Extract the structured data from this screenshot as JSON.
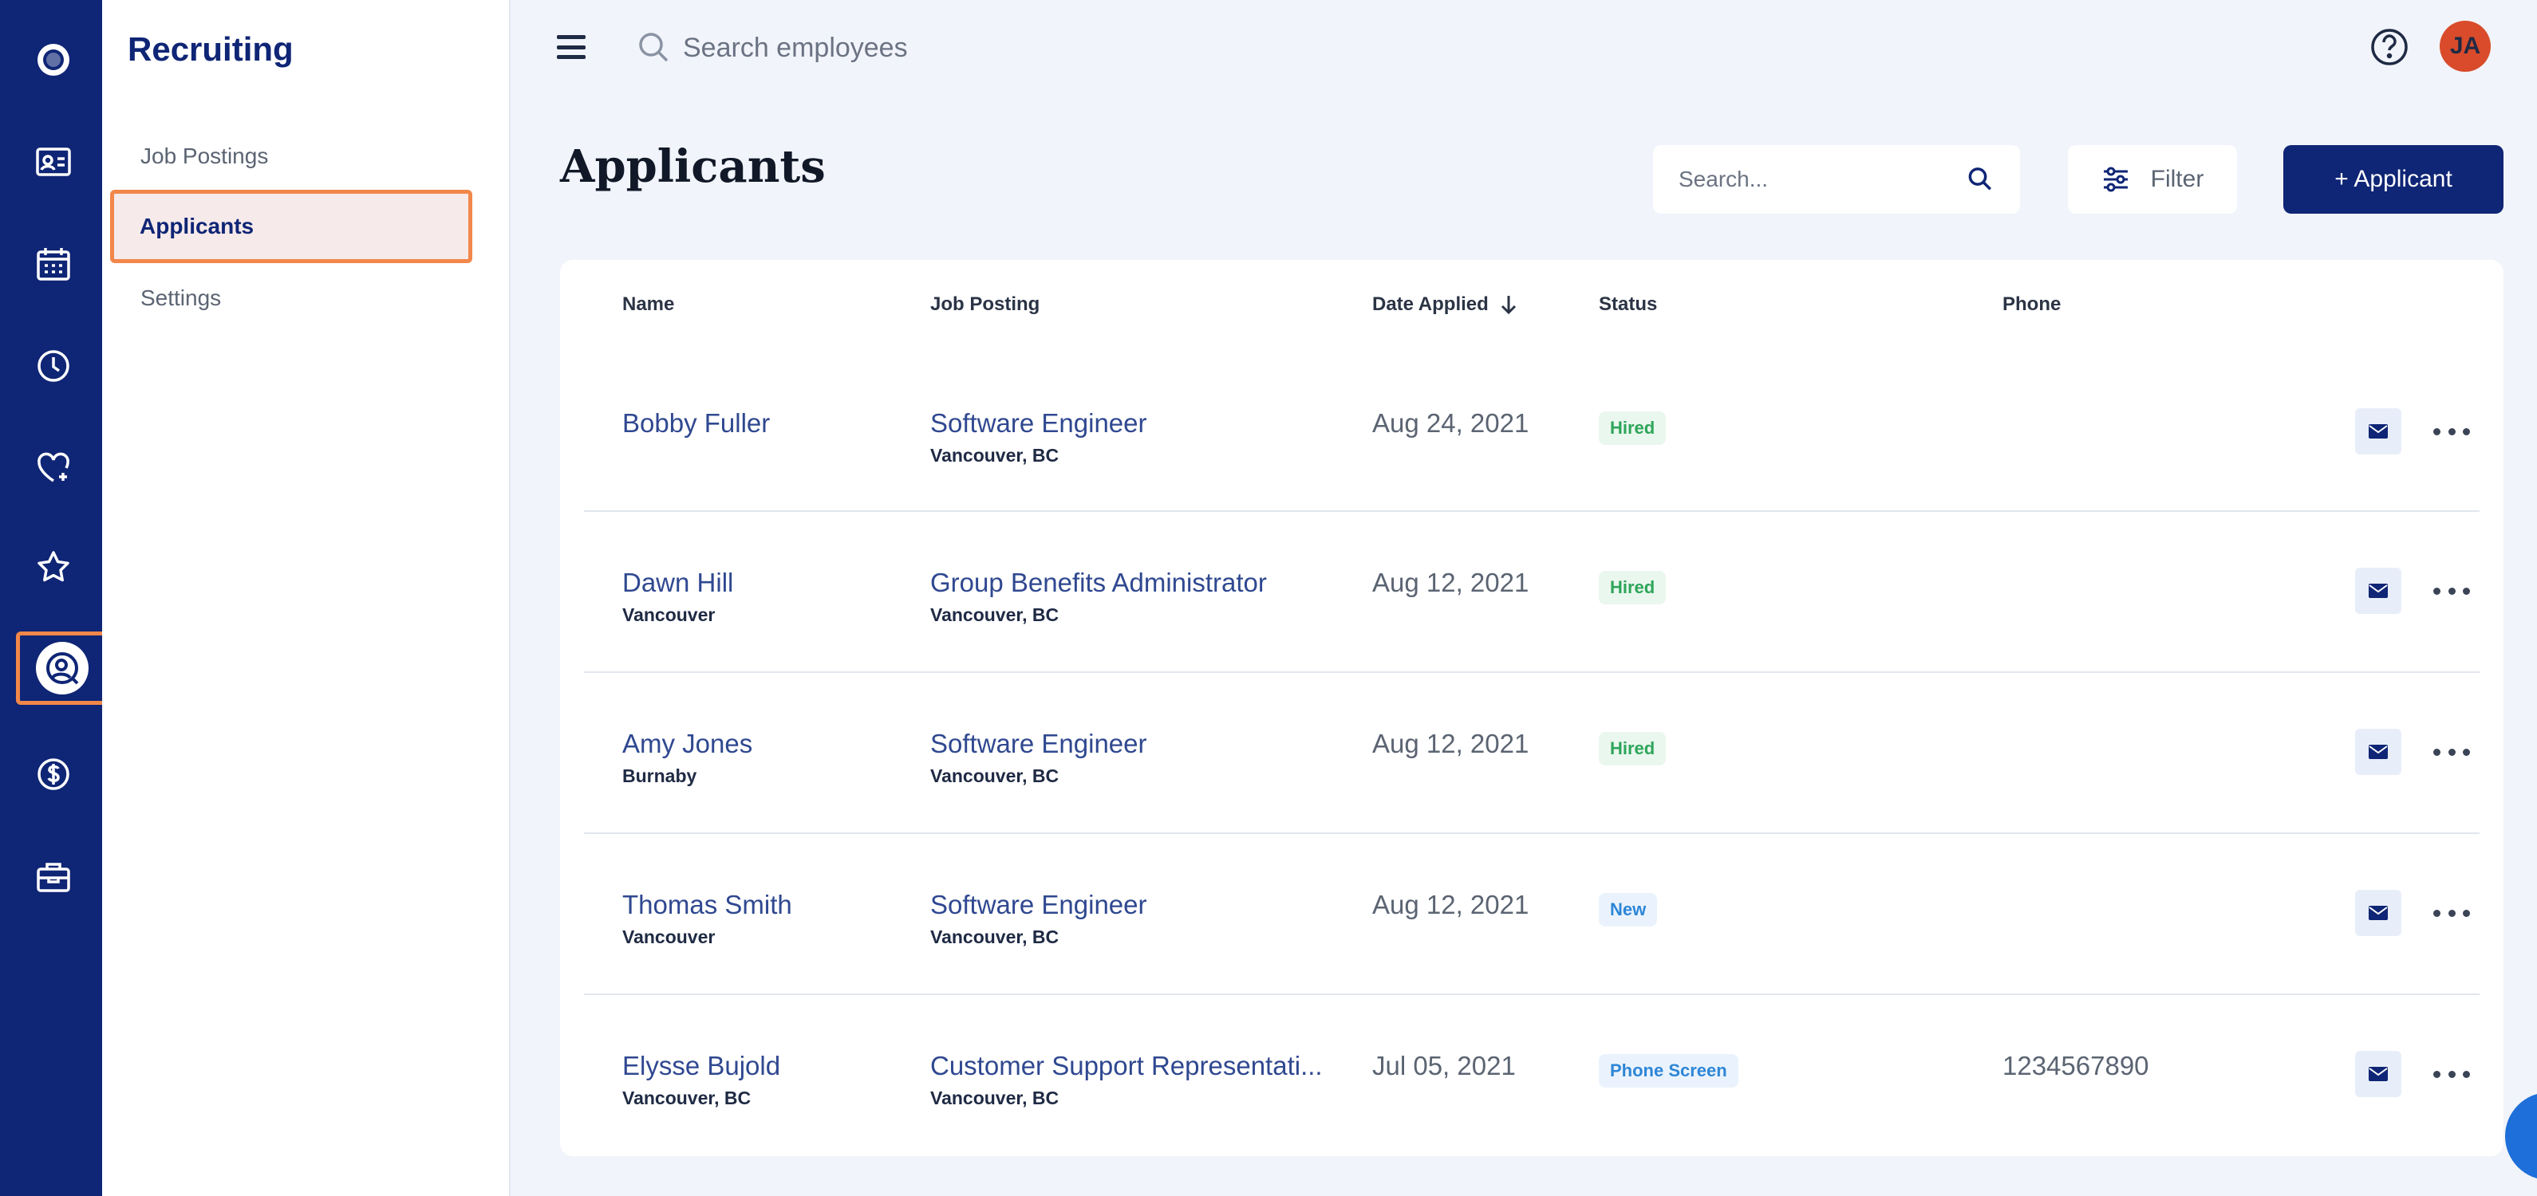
{
  "global_search": {
    "placeholder": "Search employees"
  },
  "user": {
    "initials": "JA"
  },
  "rail": {
    "items": [
      {
        "icon": "app-logo-icon"
      },
      {
        "icon": "id-card-icon"
      },
      {
        "icon": "calendar-icon"
      },
      {
        "icon": "clock-icon"
      },
      {
        "icon": "heart-plus-icon"
      },
      {
        "icon": "star-icon"
      },
      {
        "icon": "recruiting-person-search-icon",
        "active": true
      },
      {
        "icon": "dollar-icon"
      },
      {
        "icon": "toolbox-icon"
      }
    ]
  },
  "subnav": {
    "title": "Recruiting",
    "items": [
      {
        "label": "Job Postings"
      },
      {
        "label": "Applicants",
        "active": true
      },
      {
        "label": "Settings"
      }
    ]
  },
  "page": {
    "title": "Applicants",
    "search_placeholder": "Search...",
    "filter_label": "Filter",
    "add_label": "+ Applicant"
  },
  "table": {
    "columns": [
      "Name",
      "Job Posting",
      "Date Applied",
      "Status",
      "Phone"
    ],
    "rows": [
      {
        "name": "Bobby Fuller",
        "location": "",
        "job": "Software Engineer",
        "job_location": "Vancouver, BC",
        "date": "Aug 24, 2021",
        "status": "Hired",
        "phone": ""
      },
      {
        "name": "Dawn Hill",
        "location": "Vancouver",
        "job": "Group Benefits Administrator",
        "job_location": "Vancouver, BC",
        "date": "Aug 12, 2021",
        "status": "Hired",
        "phone": ""
      },
      {
        "name": "Amy Jones",
        "location": "Burnaby",
        "job": "Software Engineer",
        "job_location": "Vancouver, BC",
        "date": "Aug 12, 2021",
        "status": "Hired",
        "phone": ""
      },
      {
        "name": "Thomas Smith",
        "location": "Vancouver",
        "job": "Software Engineer",
        "job_location": "Vancouver, BC",
        "date": "Aug 12, 2021",
        "status": "New",
        "phone": ""
      },
      {
        "name": "Elysse Bujold",
        "location": "Vancouver, BC",
        "job": "Customer Support Representati...",
        "job_location": "Vancouver, BC",
        "date": "Jul 05, 2021",
        "status": "Phone Screen",
        "phone": "1234567890"
      }
    ]
  },
  "colors": {
    "brand": "#0f2575",
    "highlight": "#f2874a",
    "hired": "#2ea55a",
    "info": "#2e86d6"
  }
}
